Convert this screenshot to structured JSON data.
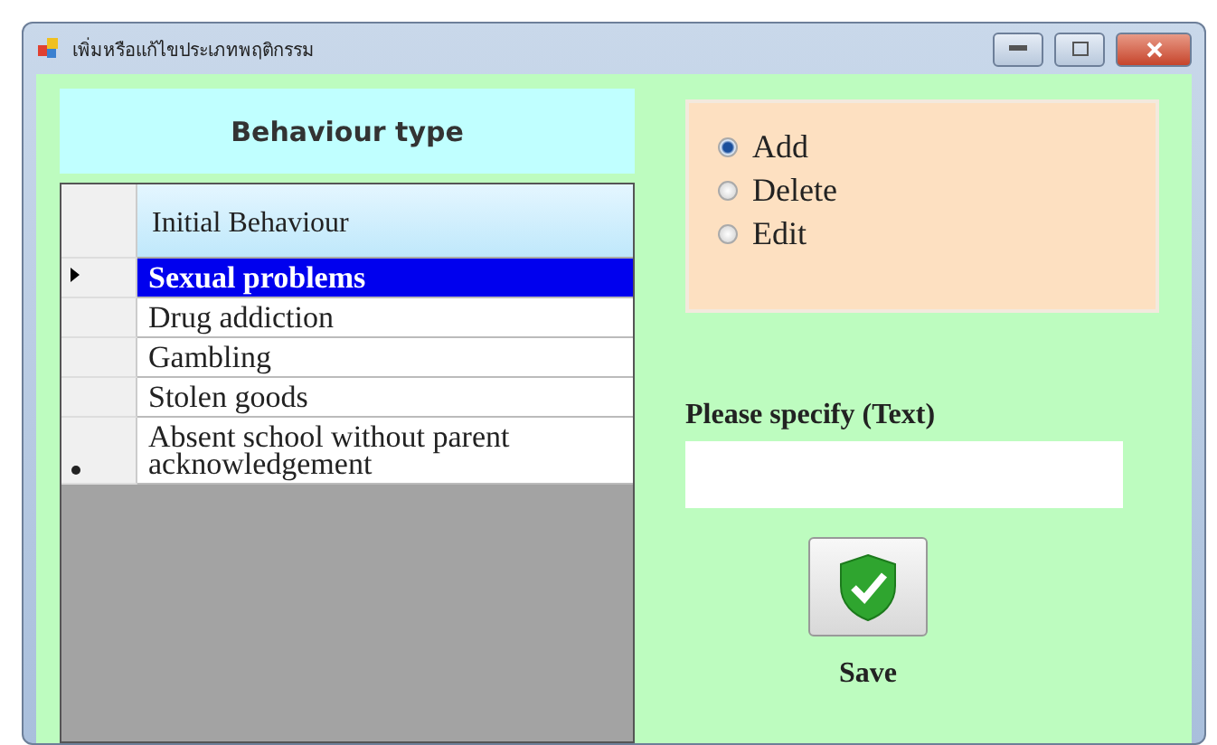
{
  "window": {
    "title": "เพิ่มหรือแก้ไขประเภทพฤติกรรม"
  },
  "left": {
    "heading": "Behaviour type",
    "table": {
      "columns": [
        "Initial Behaviour"
      ],
      "rows": [
        {
          "cell": "Sexual problems",
          "selected": true,
          "current": true,
          "new_row": false
        },
        {
          "cell": "Drug addiction",
          "selected": false,
          "current": false,
          "new_row": false
        },
        {
          "cell": "Gambling",
          "selected": false,
          "current": false,
          "new_row": false
        },
        {
          "cell": "Stolen goods",
          "selected": false,
          "current": false,
          "new_row": false
        },
        {
          "cell": "Absent school without parent acknowledgement",
          "selected": false,
          "current": false,
          "new_row": true
        }
      ]
    }
  },
  "actions": [
    {
      "label": "Add",
      "selected": true
    },
    {
      "label": "Delete",
      "selected": false
    },
    {
      "label": "Edit",
      "selected": false
    }
  ],
  "specify": {
    "label": "Please specify (Text)"
  },
  "save": {
    "label": "Save"
  }
}
